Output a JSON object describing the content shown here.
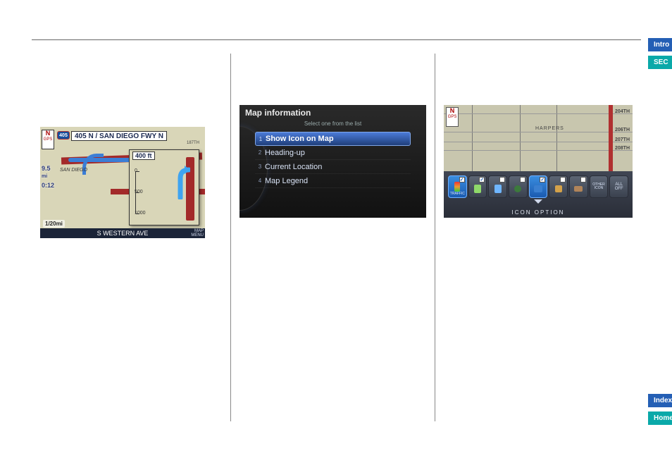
{
  "sideTabs": {
    "intro": "Intro",
    "sec": "SEC"
  },
  "botTabs": {
    "index": "Index",
    "home": "Home"
  },
  "shot1": {
    "compassTop": "N",
    "compassMid": "GPS",
    "route_shield": "405",
    "title": "405 N / SAN DIEGO FWY N",
    "dist_value": "9.5",
    "dist_unit": "mi",
    "eta_value": "0:12",
    "scale": "1/20mi",
    "footer_street": "S WESTERN AVE",
    "map_menu": "MAP\nMENU",
    "label_sandiego": "SAN DIEGO",
    "label_187": "187TH",
    "inset": {
      "dist": "400 ft",
      "tick1": "0",
      "tick2": "500",
      "tick3": "1000"
    }
  },
  "shot2": {
    "header": "Map information",
    "subtitle": "Select one from the list",
    "items": [
      {
        "n": "1",
        "label": "Show Icon on Map",
        "selected": true
      },
      {
        "n": "2",
        "label": "Heading-up",
        "selected": false
      },
      {
        "n": "3",
        "label": "Current Location",
        "selected": false
      },
      {
        "n": "4",
        "label": "Map Legend",
        "selected": false
      }
    ]
  },
  "shot3": {
    "compassTop": "N",
    "compassMid": "GPS",
    "harpers": "HARPERS",
    "streets": [
      "204TH",
      "206TH",
      "207TH",
      "208TH"
    ],
    "footer": "ICON OPTION",
    "buttons": {
      "traffic": "TRAFFIC",
      "other": "OTHER\nICON",
      "alloff": "ALL\nOFF"
    }
  }
}
